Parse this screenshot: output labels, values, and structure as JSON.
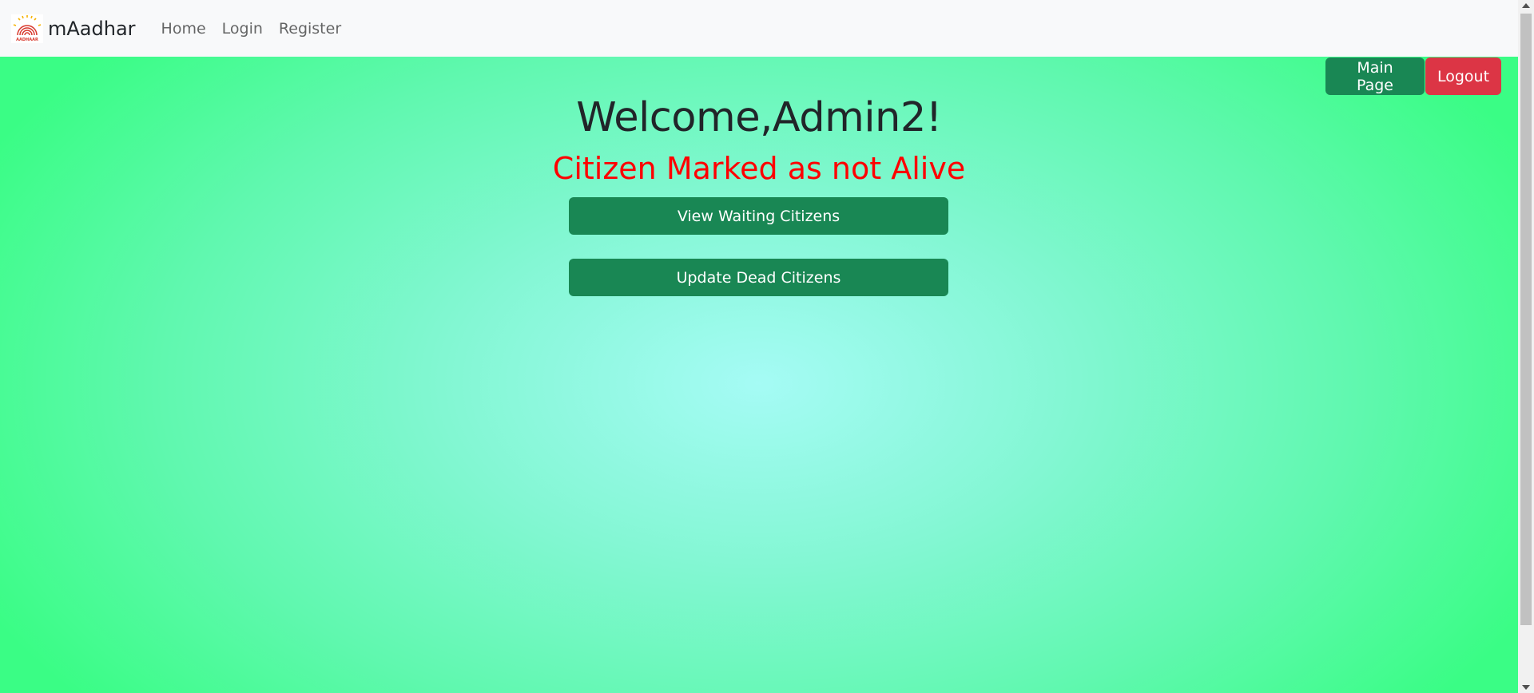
{
  "navbar": {
    "brand_name": "mAadhar",
    "logo_icon": "aadhaar-logo-icon",
    "links": [
      {
        "label": "Home"
      },
      {
        "label": "Login"
      },
      {
        "label": "Register"
      }
    ]
  },
  "top_actions": {
    "main_page_label": "Main Page",
    "logout_label": "Logout"
  },
  "main": {
    "welcome_text": "Welcome,Admin2!",
    "status_message": "Citizen Marked as not Alive",
    "view_waiting_label": "View Waiting Citizens",
    "update_dead_label": "Update Dead Citizens"
  },
  "colors": {
    "accent_green": "#198754",
    "danger_red": "#dc3545",
    "status_red": "#ff0000",
    "navbar_bg": "#f8f9fa"
  }
}
